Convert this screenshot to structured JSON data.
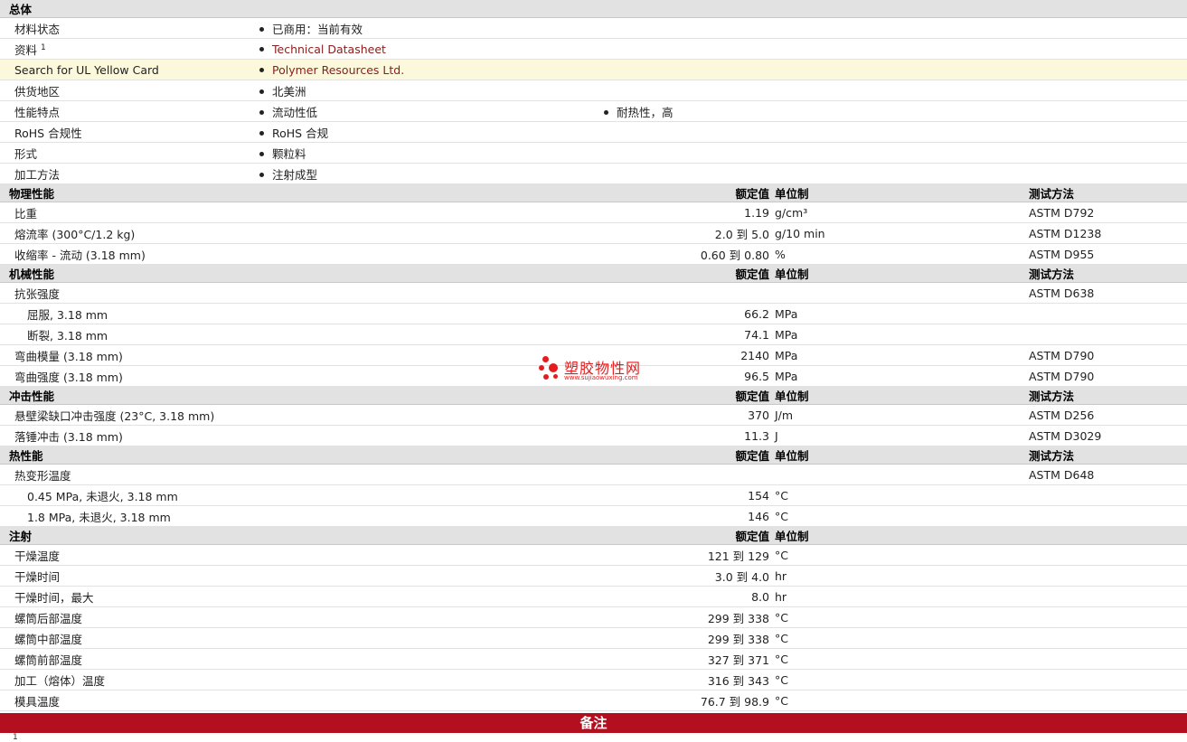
{
  "general": {
    "header": "总体",
    "rows": [
      {
        "label": "材料状态",
        "sup": "",
        "values": [
          "已商用：当前有效"
        ],
        "link": false
      },
      {
        "label": "资料",
        "sup": "1",
        "values": [
          "Technical Datasheet"
        ],
        "link": true
      },
      {
        "label": "Search for UL Yellow Card",
        "sup": "",
        "values": [
          "Polymer Resources Ltd."
        ],
        "link": true,
        "highlight": true
      },
      {
        "label": "供货地区",
        "sup": "",
        "values": [
          "北美洲"
        ],
        "link": false
      },
      {
        "label": "性能特点",
        "sup": "",
        "values": [
          "流动性低",
          "耐热性，高"
        ],
        "link": false
      },
      {
        "label": "RoHS 合规性",
        "sup": "",
        "values": [
          "RoHS 合规"
        ],
        "link": false
      },
      {
        "label": "形式",
        "sup": "",
        "values": [
          "颗粒料"
        ],
        "link": false
      },
      {
        "label": "加工方法",
        "sup": "",
        "values": [
          "注射成型"
        ],
        "link": false
      }
    ]
  },
  "columns": {
    "value": "额定值",
    "unit": "单位制",
    "method": "测试方法"
  },
  "sections": [
    {
      "title": "物理性能",
      "show_method": true,
      "rows": [
        {
          "label": "比重",
          "value": "1.19",
          "unit": "g/cm³",
          "method": "ASTM D792"
        },
        {
          "label": "熔流率  (300°C/1.2 kg)",
          "value": "2.0 到  5.0",
          "unit": "g/10 min",
          "method": "ASTM D1238"
        },
        {
          "label": "收缩率  - 流动  (3.18 mm)",
          "value": "0.60 到  0.80",
          "unit": "%",
          "method": "ASTM D955"
        }
      ]
    },
    {
      "title": "机械性能",
      "show_method": true,
      "rows": [
        {
          "label": "抗张强度",
          "value": "",
          "unit": "",
          "method": "ASTM D638"
        },
        {
          "label": "屈服, 3.18 mm",
          "value": "66.2",
          "unit": "MPa",
          "method": "",
          "sub": true
        },
        {
          "label": "断裂, 3.18 mm",
          "value": "74.1",
          "unit": "MPa",
          "method": "",
          "sub": true
        },
        {
          "label": "弯曲模量  (3.18 mm)",
          "value": "2140",
          "unit": "MPa",
          "method": "ASTM D790"
        },
        {
          "label": "弯曲强度  (3.18 mm)",
          "value": "96.5",
          "unit": "MPa",
          "method": "ASTM D790"
        }
      ]
    },
    {
      "title": "冲击性能",
      "show_method": true,
      "rows": [
        {
          "label": "悬壁梁缺口冲击强度  (23°C, 3.18 mm)",
          "value": "370",
          "unit": "J/m",
          "method": "ASTM D256"
        },
        {
          "label": "落锤冲击  (3.18 mm)",
          "value": "11.3",
          "unit": "J",
          "method": "ASTM D3029"
        }
      ]
    },
    {
      "title": "热性能",
      "show_method": true,
      "rows": [
        {
          "label": "热变形温度",
          "value": "",
          "unit": "",
          "method": "ASTM D648"
        },
        {
          "label": "0.45 MPa, 未退火, 3.18 mm",
          "value": "154",
          "unit": "°C",
          "method": "",
          "sub": true
        },
        {
          "label": "1.8 MPa, 未退火, 3.18 mm",
          "value": "146",
          "unit": "°C",
          "method": "",
          "sub": true
        }
      ]
    },
    {
      "title": "注射",
      "show_method": false,
      "rows": [
        {
          "label": "干燥温度",
          "value": "121 到  129",
          "unit": "°C",
          "method": ""
        },
        {
          "label": "干燥时间",
          "value": "3.0 到  4.0",
          "unit": "hr",
          "method": ""
        },
        {
          "label": "干燥时间，最大",
          "value": "8.0",
          "unit": "hr",
          "method": ""
        },
        {
          "label": "螺筒后部温度",
          "value": "299 到  338",
          "unit": "°C",
          "method": ""
        },
        {
          "label": "螺筒中部温度",
          "value": "299 到  338",
          "unit": "°C",
          "method": ""
        },
        {
          "label": "螺筒前部温度",
          "value": "327 到  371",
          "unit": "°C",
          "method": ""
        },
        {
          "label": "加工（熔体）温度",
          "value": "316 到  343",
          "unit": "°C",
          "method": ""
        },
        {
          "label": "模具温度",
          "value": "76.7 到  98.9",
          "unit": "°C",
          "method": ""
        }
      ]
    }
  ],
  "remarks": {
    "title": "备注",
    "footnote": "1"
  },
  "watermark": {
    "name": "塑胶物性网",
    "url": "www.sujiaowuxing.com",
    "color": "#e31d1d"
  }
}
